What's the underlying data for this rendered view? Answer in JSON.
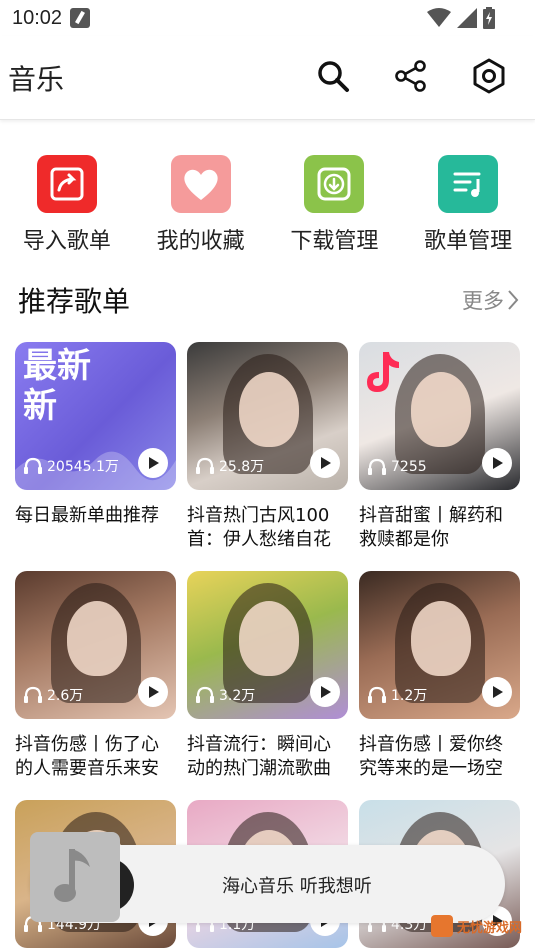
{
  "status_bar": {
    "time": "10:02"
  },
  "app_bar": {
    "title": "音乐",
    "actions": [
      {
        "icon": "search-icon"
      },
      {
        "icon": "share-icon"
      },
      {
        "icon": "settings-icon"
      }
    ]
  },
  "shortcuts": [
    {
      "label": "导入歌单",
      "icon": "import-playlist-icon",
      "color": "#ef2a2a"
    },
    {
      "label": "我的收藏",
      "icon": "heart-icon",
      "color": "#f59b9b"
    },
    {
      "label": "下载管理",
      "icon": "download-icon",
      "color": "#8bc34a"
    },
    {
      "label": "歌单管理",
      "icon": "playlist-manage-icon",
      "color": "#26b99a"
    }
  ],
  "section": {
    "title": "推荐歌单",
    "more": "更多"
  },
  "playlists": [
    {
      "cover_text": "最新",
      "cover_text2": "新",
      "plays": "20545.1万",
      "title": "每日最新单曲推荐"
    },
    {
      "plays": "25.8万",
      "title": "抖音热门古风100首：伊人愁绪自花"
    },
    {
      "plays": "7255",
      "title": "抖音甜蜜丨解药和救赎都是你"
    },
    {
      "plays": "2.6万",
      "title": "抖音伤感丨伤了心的人需要音乐来安"
    },
    {
      "plays": "3.2万",
      "title": "抖音流行：瞬间心动的热门潮流歌曲"
    },
    {
      "plays": "1.2万",
      "title": "抖音伤感丨爱你终究等来的是一场空"
    },
    {
      "plays": "144.9万",
      "title": ""
    },
    {
      "plays": "1.1万",
      "title": ""
    },
    {
      "plays": "4.3万",
      "title": ""
    }
  ],
  "player": {
    "text": "海心音乐 听我想听"
  },
  "watermark": {
    "text": "无忧游戏网"
  }
}
